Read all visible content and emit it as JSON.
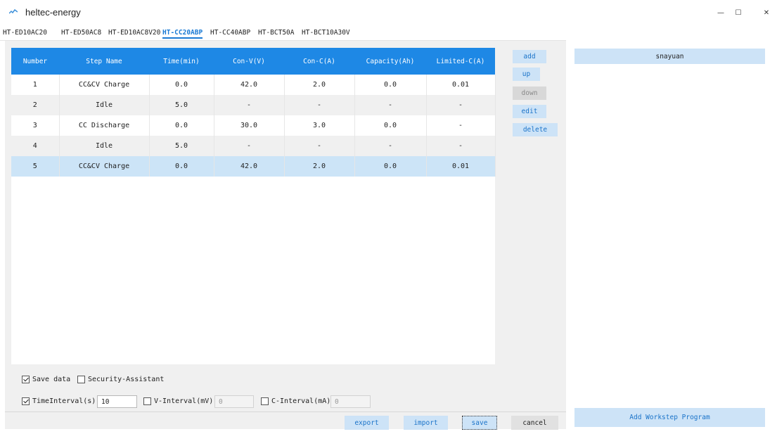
{
  "window": {
    "title": "heltec-energy",
    "minimize": "—",
    "maximize": "☐",
    "close": "✕"
  },
  "tabs": [
    {
      "label": "HT-ED10AC20",
      "active": false
    },
    {
      "label": "HT-ED50AC8",
      "active": false
    },
    {
      "label": "HT-ED10AC8V20",
      "active": false
    },
    {
      "label": "HT-CC20ABP",
      "active": true
    },
    {
      "label": "HT-CC40ABP",
      "active": false
    },
    {
      "label": "HT-BCT50A",
      "active": false
    },
    {
      "label": "HT-BCT10A30V",
      "active": false
    }
  ],
  "table": {
    "headers": [
      "Number",
      "Step Name",
      "Time(min)",
      "Con-V(V)",
      "Con-C(A)",
      "Capacity(Ah)",
      "Limited-C(A)"
    ],
    "rows": [
      [
        "1",
        "CC&CV Charge",
        "0.0",
        "42.0",
        "2.0",
        "0.0",
        "0.01"
      ],
      [
        "2",
        "Idle",
        "5.0",
        "-",
        "-",
        "-",
        "-"
      ],
      [
        "3",
        "CC Discharge",
        "0.0",
        "30.0",
        "3.0",
        "0.0",
        "-"
      ],
      [
        "4",
        "Idle",
        "5.0",
        "-",
        "-",
        "-",
        "-"
      ],
      [
        "5",
        "CC&CV Charge",
        "0.0",
        "42.0",
        "2.0",
        "0.0",
        "0.01"
      ]
    ],
    "selected_row": "5"
  },
  "side_buttons": {
    "add": "add",
    "up": "up",
    "down": "down",
    "edit": "edit",
    "delete": "delete"
  },
  "options": {
    "save_data": {
      "label": "Save data",
      "checked": true
    },
    "security_assistant": {
      "label": "Security-Assistant",
      "checked": false
    },
    "time_interval": {
      "label": "TimeInterval(s)",
      "checked": true,
      "value": "10"
    },
    "v_interval": {
      "label": "V-Interval(mV)",
      "checked": false,
      "value": "0"
    },
    "c_interval": {
      "label": "C-Interval(mA)",
      "checked": false,
      "value": "0"
    }
  },
  "bottom_buttons": {
    "export": "export",
    "import": "import",
    "save": "save",
    "cancel": "cancel"
  },
  "right_panel": {
    "header": "snayuan",
    "footer": "Add Workstep Program"
  },
  "colors": {
    "accent": "#1e88e5",
    "button_bg": "#cde3f7",
    "selected_row": "#cce4f7"
  }
}
